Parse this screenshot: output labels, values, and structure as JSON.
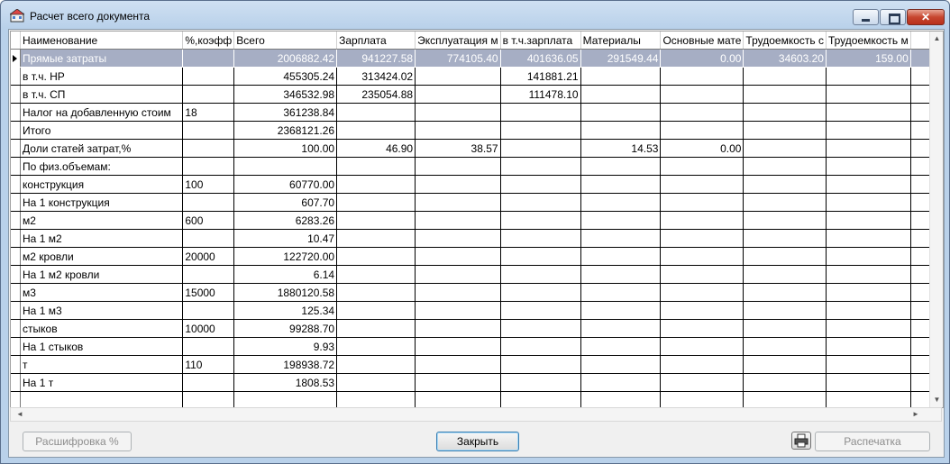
{
  "window": {
    "title": "Расчет всего документа",
    "minimize_glyph": "",
    "maximize_glyph": "",
    "close_glyph": "✕"
  },
  "grid": {
    "columns": [
      "Наименование",
      "%,коэфф",
      "Всего",
      "Зарплата",
      "Эксплуатация м",
      "в т.ч.зарплата",
      "Материалы",
      "Основные мате",
      "Трудоемкость с",
      "Трудоемкость м",
      ""
    ],
    "selected_row": 0,
    "rows": [
      [
        "Прямые затраты",
        "",
        "2006882.42",
        "941227.58",
        "774105.40",
        "401636.05",
        "291549.44",
        "0.00",
        "34603.20",
        "159.00",
        ""
      ],
      [
        "в т.ч. НР",
        "",
        "455305.24",
        "313424.02",
        "",
        "141881.21",
        "",
        "",
        "",
        "",
        ""
      ],
      [
        "в т.ч. СП",
        "",
        "346532.98",
        "235054.88",
        "",
        "111478.10",
        "",
        "",
        "",
        "",
        ""
      ],
      [
        "Налог на добавленную стоим",
        "18",
        "361238.84",
        "",
        "",
        "",
        "",
        "",
        "",
        "",
        ""
      ],
      [
        "Итого",
        "",
        "2368121.26",
        "",
        "",
        "",
        "",
        "",
        "",
        "",
        ""
      ],
      [
        "Доли статей затрат,%",
        "",
        "100.00",
        "46.90",
        "38.57",
        "",
        "14.53",
        "0.00",
        "",
        "",
        ""
      ],
      [
        "По физ.объемам:",
        "",
        "",
        "",
        "",
        "",
        "",
        "",
        "",
        "",
        ""
      ],
      [
        "конструкция",
        "100",
        "60770.00",
        "",
        "",
        "",
        "",
        "",
        "",
        "",
        ""
      ],
      [
        "На 1 конструкция",
        "",
        "607.70",
        "",
        "",
        "",
        "",
        "",
        "",
        "",
        ""
      ],
      [
        "м2",
        "600",
        "6283.26",
        "",
        "",
        "",
        "",
        "",
        "",
        "",
        ""
      ],
      [
        "На 1 м2",
        "",
        "10.47",
        "",
        "",
        "",
        "",
        "",
        "",
        "",
        ""
      ],
      [
        "м2 кровли",
        "20000",
        "122720.00",
        "",
        "",
        "",
        "",
        "",
        "",
        "",
        ""
      ],
      [
        "На 1 м2 кровли",
        "",
        "6.14",
        "",
        "",
        "",
        "",
        "",
        "",
        "",
        ""
      ],
      [
        "м3",
        "15000",
        "1880120.58",
        "",
        "",
        "",
        "",
        "",
        "",
        "",
        ""
      ],
      [
        "На 1 м3",
        "",
        "125.34",
        "",
        "",
        "",
        "",
        "",
        "",
        "",
        ""
      ],
      [
        "стыков",
        "10000",
        "99288.70",
        "",
        "",
        "",
        "",
        "",
        "",
        "",
        ""
      ],
      [
        "На 1 стыков",
        "",
        "9.93",
        "",
        "",
        "",
        "",
        "",
        "",
        "",
        ""
      ],
      [
        "т",
        "110",
        "198938.72",
        "",
        "",
        "",
        "",
        "",
        "",
        "",
        ""
      ],
      [
        "На 1 т",
        "",
        "1808.53",
        "",
        "",
        "",
        "",
        "",
        "",
        "",
        ""
      ],
      [
        "",
        "",
        "",
        "",
        "",
        "",
        "",
        "",
        "",
        "",
        ""
      ]
    ]
  },
  "scrollbars": {
    "up": "▲",
    "down": "▼",
    "left": "◄",
    "right": "►"
  },
  "buttons": {
    "decode": "Расшифровка %",
    "close": "Закрыть",
    "print": "Распечатка"
  },
  "icons": {
    "title": "app-icon",
    "printer": "printer-icon"
  }
}
